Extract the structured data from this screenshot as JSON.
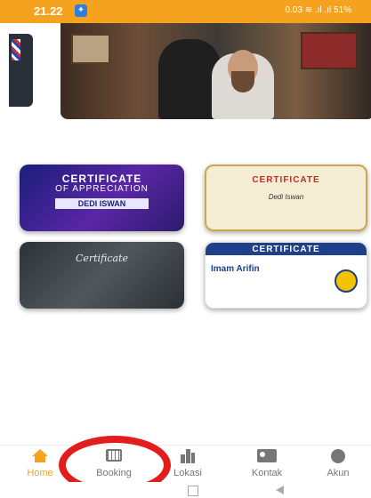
{
  "status_bar": {
    "time": "21.22",
    "right_text": "0.03 ≋ .ıl .ıl 51%"
  },
  "hero": {
    "description_icon": "barber-photo"
  },
  "certificates": [
    {
      "title": "CERTIFICATE",
      "subtitle": "OF APPRECIATION",
      "name": "DEDI ISWAN"
    },
    {
      "title": "CERTIFICATE",
      "name": "Dedi Iswan"
    },
    {
      "title": "Certificate"
    },
    {
      "title": "CERTIFICATE",
      "name": "Imam Arifin"
    }
  ],
  "nav": {
    "items": [
      {
        "label": "Home",
        "icon": "home-icon",
        "active": true
      },
      {
        "label": "Booking",
        "icon": "calendar-icon"
      },
      {
        "label": "Lokasi",
        "icon": "building-icon"
      },
      {
        "label": "Kontak",
        "icon": "contact-icon"
      },
      {
        "label": "Akun",
        "icon": "user-icon"
      }
    ]
  },
  "colors": {
    "accent": "#f5a21f",
    "highlight_circle": "#e31c1c"
  }
}
